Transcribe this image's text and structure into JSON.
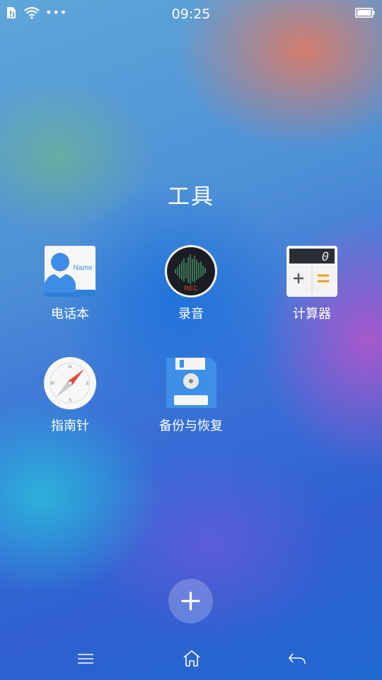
{
  "status_bar": {
    "time": "09:25",
    "icons": [
      "sim-card-icon",
      "wifi-icon",
      "more-dots-icon",
      "battery-icon"
    ],
    "more_dots": "•••"
  },
  "folder": {
    "title": "工具",
    "apps": [
      {
        "label": "电话本",
        "icon": "contacts-icon",
        "icon_text": "Name"
      },
      {
        "label": "录音",
        "icon": "recorder-icon",
        "icon_text": "REC"
      },
      {
        "label": "计算器",
        "icon": "calculator-icon",
        "icon_text": "0"
      },
      {
        "label": "指南针",
        "icon": "compass-icon"
      },
      {
        "label": "备份与恢复",
        "icon": "backup-restore-icon"
      }
    ]
  },
  "add_button": {
    "icon": "plus-icon"
  },
  "nav_bar": {
    "icons": [
      "menu-icon",
      "home-icon",
      "back-icon"
    ]
  },
  "colors": {
    "contacts_blue": "#3d8de6",
    "backup_blue": "#3e8fe8",
    "rec_red": "#e64a2e",
    "calc_orange": "#f39c12",
    "compass_red": "#e34b3b"
  }
}
